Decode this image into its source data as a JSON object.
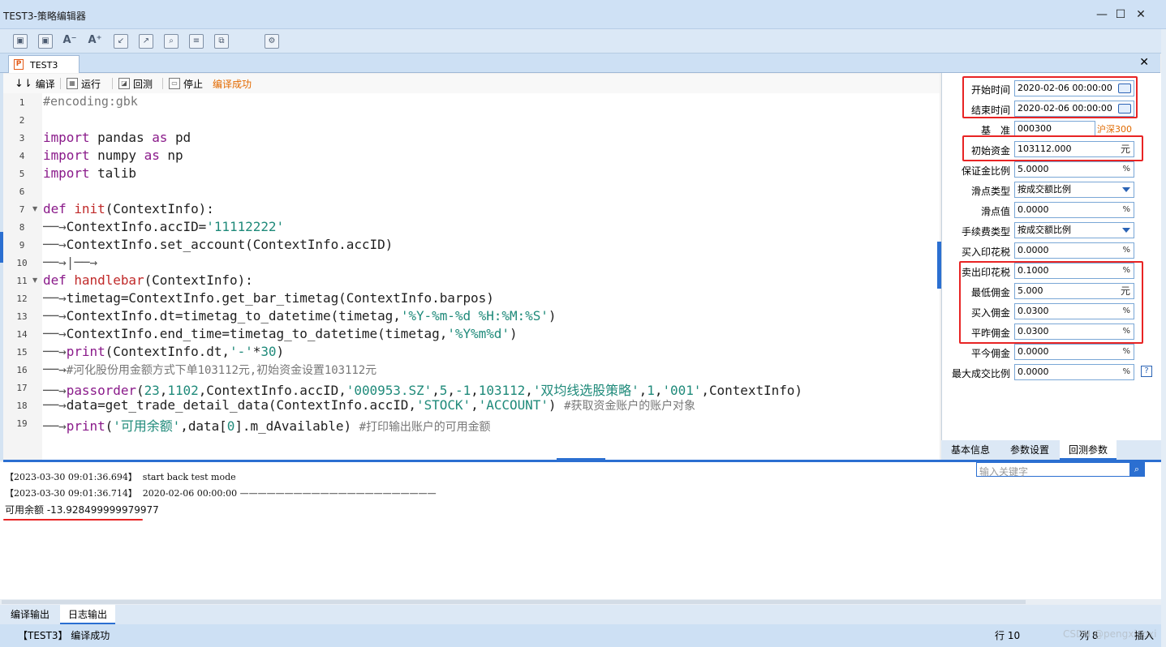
{
  "window": {
    "title": "TEST3-策略编辑器",
    "minimize_icon": "minimize-icon",
    "maximize_icon": "maximize-icon",
    "close_icon": "close-icon"
  },
  "toolbar": {
    "icons": [
      "save-icon",
      "save-as-icon",
      "font-decrease-icon",
      "font-increase-icon",
      "import-icon",
      "export-icon",
      "find-icon",
      "document-icon",
      "copy-icon",
      "settings-icon"
    ]
  },
  "doc_tab": {
    "label": "TEST3",
    "icon": "P"
  },
  "editor_toolbar": {
    "compile": "编译",
    "run": "运行",
    "backtest": "回测",
    "stop": "停止",
    "status": "编译成功"
  },
  "code_lines": [
    {
      "n": "1"
    },
    {
      "n": "2"
    },
    {
      "n": "3"
    },
    {
      "n": "4"
    },
    {
      "n": "5"
    },
    {
      "n": "6"
    },
    {
      "n": "7"
    },
    {
      "n": "8"
    },
    {
      "n": "9"
    },
    {
      "n": "10"
    },
    {
      "n": "11"
    },
    {
      "n": "12"
    },
    {
      "n": "13"
    },
    {
      "n": "14"
    },
    {
      "n": "15"
    },
    {
      "n": "16"
    },
    {
      "n": "17"
    },
    {
      "n": "18"
    },
    {
      "n": "19"
    }
  ],
  "code": {
    "l1": "#encoding:gbk",
    "import": "import",
    "as": "as",
    "l3_mod": "pandas",
    "l3_alias": "pd",
    "l4_mod": "numpy",
    "l4_alias": "np",
    "l5_mod": "talib",
    "def": "def",
    "l7_fn": "init",
    "l7_arg": "(ContextInfo):",
    "l8_a": "ContextInfo.accID=",
    "l8_s": "'11112222'",
    "l9": "ContextInfo.set_account(ContextInfo.accID)",
    "l11_fn": "handlebar",
    "l11_arg": "(ContextInfo):",
    "l12": "timetag=ContextInfo.get_bar_timetag(ContextInfo.barpos)",
    "l13_a": "ContextInfo.dt=timetag_to_datetime(timetag,",
    "l13_s": "'%Y-%m-%d %H:%M:%S'",
    "l13_b": ")",
    "l14_a": "ContextInfo.end_time=timetag_to_datetime(timetag,",
    "l14_s": "'%Y%m%d'",
    "l14_b": ")",
    "print": "print",
    "l15_a": "(ContextInfo.dt,",
    "l15_s": "'-'",
    "l15_b": "*",
    "l15_n": "30",
    "l15_c": ")",
    "l16": "#河化股份用金额方式下单103112元,初始资金设置103112元",
    "l17_fn": "passorder",
    "l17_p1": "(",
    "l17_n1": "23",
    "l17_c1": ",",
    "l17_n2": "1102",
    "l17_c2": ",ContextInfo.accID,",
    "l17_s1": "'000953.SZ'",
    "l17_c3": ",",
    "l17_n3": "5",
    "l17_c4": ",",
    "l17_n4": "-1",
    "l17_c5": ",",
    "l17_n5": "103112",
    "l17_c6": ",",
    "l17_s2": "'双均线选股策略'",
    "l17_c7": ",",
    "l17_n6": "1",
    "l17_c8": ",",
    "l17_s3": "'001'",
    "l17_c9": ",ContextInfo)",
    "l18_a": "data=get_trade_detail_data(ContextInfo.accID,",
    "l18_s1": "'STOCK'",
    "l18_c": ",",
    "l18_s2": "'ACCOUNT'",
    "l18_b": ")",
    "l18_cm": "#获取资金账户的账户对象",
    "l19_p": "(",
    "l19_s": "'可用余额'",
    "l19_a": ",data[",
    "l19_n": "0",
    "l19_b": "].m_dAvailable)",
    "l19_cm": "#打印输出账户的可用金额"
  },
  "params": {
    "start_time": {
      "label": "开始时间",
      "value": "2020-02-06 00:00:00"
    },
    "end_time": {
      "label": "结束时间",
      "value": "2020-02-06 00:00:00"
    },
    "benchmark": {
      "label": "基　准",
      "value": "000300",
      "name": "沪深300"
    },
    "initial_capital": {
      "label": "初始资金",
      "value": "103112.000",
      "unit": "元"
    },
    "margin_ratio": {
      "label": "保证金比例",
      "value": "5.0000",
      "unit": "%"
    },
    "slippage_type": {
      "label": "滑点类型",
      "value": "按成交额比例"
    },
    "slippage_value": {
      "label": "滑点值",
      "value": "0.0000",
      "unit": "%"
    },
    "fee_type": {
      "label": "手续费类型",
      "value": "按成交额比例"
    },
    "buy_stamp_tax": {
      "label": "买入印花税",
      "value": "0.0000",
      "unit": "%"
    },
    "sell_stamp_tax": {
      "label": "卖出印花税",
      "value": "0.1000",
      "unit": "%"
    },
    "min_commission": {
      "label": "最低佣金",
      "value": "5.000",
      "unit": "元"
    },
    "buy_commission": {
      "label": "买入佣金",
      "value": "0.0300",
      "unit": "%"
    },
    "close_yesterday_commission": {
      "label": "平昨佣金",
      "value": "0.0300",
      "unit": "%"
    },
    "close_today_commission": {
      "label": "平今佣金",
      "value": "0.0000",
      "unit": "%"
    },
    "max_volume_ratio": {
      "label": "最大成交比例",
      "value": "0.0000",
      "unit": "%",
      "help": "?"
    }
  },
  "right_tabs": [
    "基本信息",
    "参数设置",
    "回测参数"
  ],
  "output": {
    "search_placeholder": "输入关键字",
    "lines": [
      "【2023-03-30 09:01:36.694】  start back test mode",
      "【2023-03-30 09:01:36.714】  2020-02-06 00:00:00 ——————————————————————",
      "可用余额 -13.928499999979977"
    ]
  },
  "bottom_tabs": [
    "编译输出",
    "日志输出"
  ],
  "status": {
    "message": "【TEST3】 编译成功",
    "row": "行 10",
    "col": "列 8",
    "watermark": "CSDN @pengxiaoxi",
    "mode": "插入"
  }
}
